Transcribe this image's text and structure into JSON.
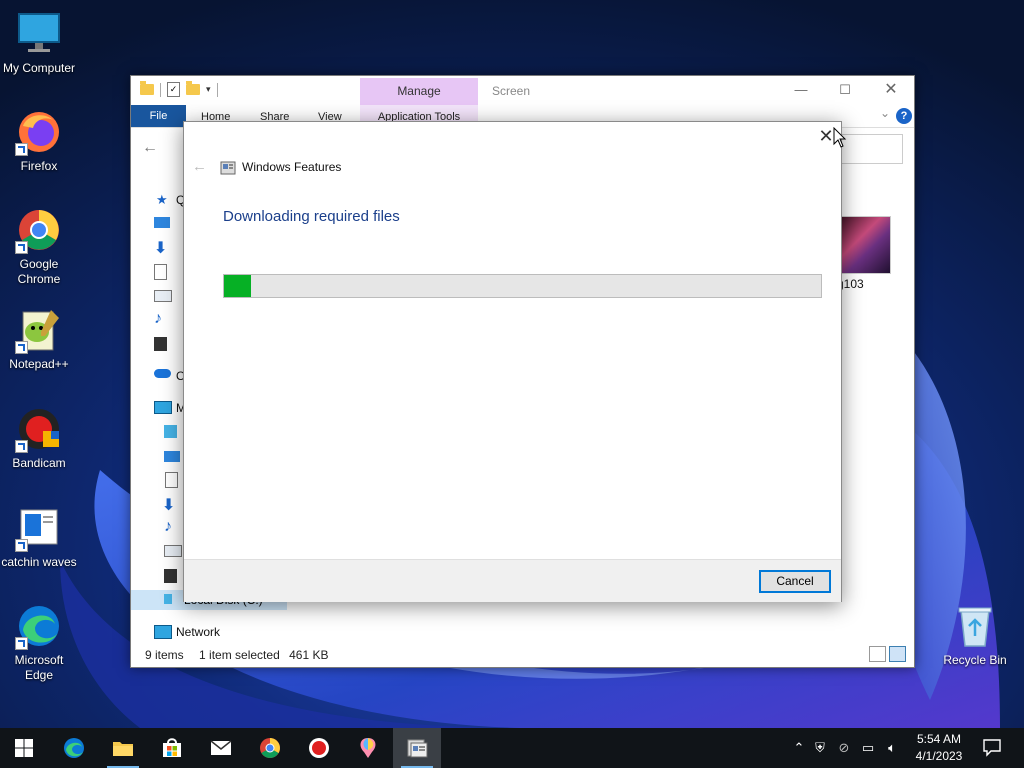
{
  "desktop": {
    "icons": [
      {
        "label": "My Computer"
      },
      {
        "label": "Firefox"
      },
      {
        "label": "Google Chrome"
      },
      {
        "label": "Notepad++"
      },
      {
        "label": "Bandicam"
      },
      {
        "label": "catchin waves"
      },
      {
        "label": "Microsoft Edge"
      },
      {
        "label": "Recycle Bin"
      }
    ]
  },
  "explorer": {
    "title": "Screen",
    "manage_tab": "Manage",
    "ribbon": {
      "file": "File",
      "home": "Home",
      "share": "Share",
      "view": "View",
      "app_tools": "Application Tools"
    },
    "sidebar": {
      "quick_access_initial": "Q",
      "onedrive_initial": "O",
      "this_pc_initial": "M",
      "local_disk": "Local Disk (C:)",
      "network": "Network"
    },
    "file_label": "g103",
    "status": {
      "items": "9 items",
      "selected": "1 item selected",
      "size": "461 KB"
    }
  },
  "dialog": {
    "app_name": "Windows Features",
    "heading": "Downloading required files",
    "progress": 0.045,
    "cancel_label": "Cancel"
  },
  "taskbar": {
    "time": "5:54 AM",
    "date": "4/1/2023"
  },
  "colors": {
    "progress_fill": "#06b025",
    "accent": "#0078d7",
    "heading": "#1b3f8b"
  }
}
